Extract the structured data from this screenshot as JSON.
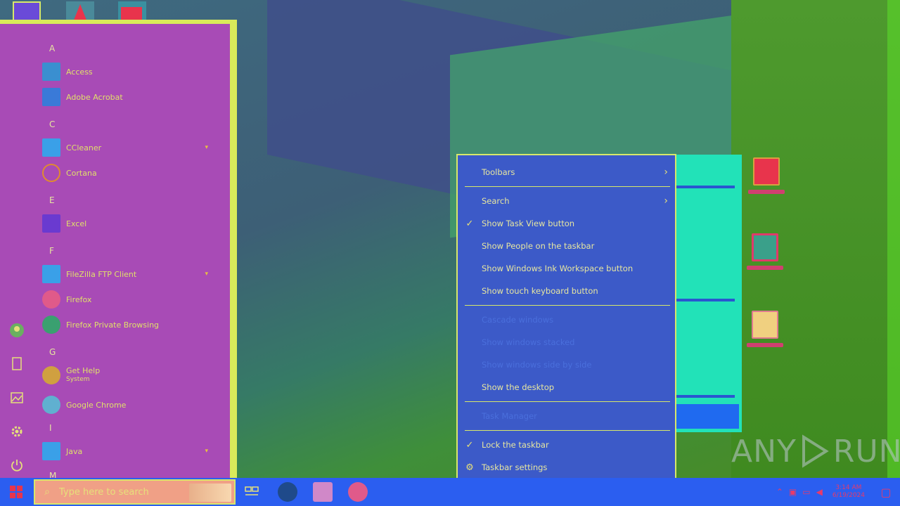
{
  "start_menu": {
    "letters": [
      "A",
      "C",
      "E",
      "F",
      "G",
      "I",
      "M"
    ],
    "apps": [
      {
        "name": "Access",
        "color": "#3a8fd0"
      },
      {
        "name": "Adobe Acrobat",
        "color": "#3a7ad8"
      },
      {
        "name": "CCleaner",
        "color": "#3aa0e8",
        "folder": true
      },
      {
        "name": "Cortana",
        "color": "#e08a30"
      },
      {
        "name": "Excel",
        "color": "#6a3ad0"
      },
      {
        "name": "FileZilla FTP Client",
        "color": "#3aa0e8",
        "folder": true
      },
      {
        "name": "Firefox",
        "color": "#e05a8a"
      },
      {
        "name": "Firefox Private Browsing",
        "color": "#3aa070"
      },
      {
        "name": "Get Help",
        "sub": "System",
        "color": "#d0a040"
      },
      {
        "name": "Google Chrome",
        "color": "#60b0d0"
      },
      {
        "name": "Java",
        "color": "#3aa0e8",
        "folder": true
      }
    ],
    "rail_icons": [
      "user-icon",
      "document-icon",
      "pictures-icon",
      "settings-icon",
      "power-icon"
    ]
  },
  "context_menu": {
    "items": [
      {
        "label": "Toolbars",
        "submenu": true
      },
      {
        "label": "Search",
        "submenu": true
      },
      {
        "label": "Show Task View button",
        "checked": true
      },
      {
        "label": "Show People on the taskbar"
      },
      {
        "label": "Show Windows Ink Workspace button"
      },
      {
        "label": "Show touch keyboard button"
      },
      {
        "label": "Cascade windows",
        "disabled": true
      },
      {
        "label": "Show windows stacked",
        "disabled": true
      },
      {
        "label": "Show windows side by side",
        "disabled": true
      },
      {
        "label": "Show the desktop"
      },
      {
        "label": "Task Manager",
        "disabled": true
      },
      {
        "label": "Lock the taskbar",
        "checked": true
      },
      {
        "label": "Taskbar settings",
        "gear": true
      }
    ]
  },
  "taskbar": {
    "search_placeholder": "Type here to search",
    "clock_time": "3:14 AM",
    "clock_date": "6/19/2024"
  },
  "watermark": {
    "left": "ANY",
    "right": "RUN"
  },
  "colors": {
    "menu_bg": "#3c5ac8",
    "start_bg": "#a84bb6",
    "accent": "#d8e86a",
    "taskbar": "#2b5ef0"
  }
}
